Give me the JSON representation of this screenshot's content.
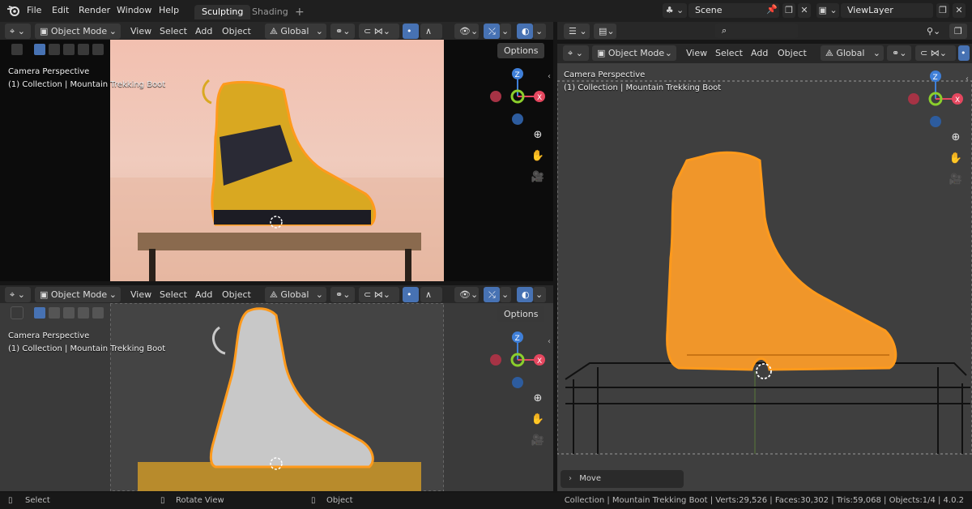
{
  "menu": {
    "file": "File",
    "edit": "Edit",
    "render": "Render",
    "window": "Window",
    "help": "Help"
  },
  "workspaces": {
    "sculpting": "Sculpting",
    "shading": "Shading",
    "add": "+"
  },
  "scene": {
    "name": "Scene",
    "view_layer": "ViewLayer"
  },
  "viewport_header": {
    "mode": "Object Mode",
    "view": "View",
    "select": "Select",
    "add": "Add",
    "object": "Object",
    "orientation": "Global",
    "options": "Options"
  },
  "viewport_overlay": {
    "perspective": "Camera Perspective",
    "collection": "(1) Collection | Mountain Trekking Boot"
  },
  "gizmo": {
    "z": "Z",
    "x": "X"
  },
  "operator_panel": {
    "label": "Move"
  },
  "statusbar": {
    "select": "Select",
    "rotate_view": "Rotate View",
    "object": "Object",
    "info": "Collection | Mountain Trekking Boot | Verts:29,526 | Faces:30,302 | Tris:59,068 | Objects:1/4 | 4.0.2"
  },
  "colors": {
    "accent": "#4772b3",
    "selection": "#ff9a1c",
    "axis_x": "#e5475f",
    "axis_y": "#8bcf2c",
    "axis_z": "#3f7fd8"
  }
}
